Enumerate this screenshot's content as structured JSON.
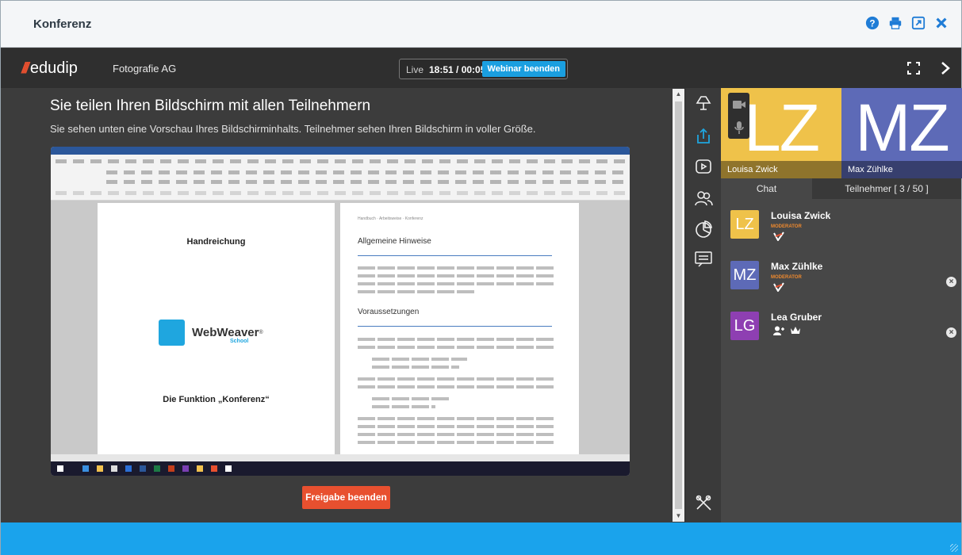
{
  "window": {
    "title": "Konferenz"
  },
  "titlebar_icons": [
    "help-icon",
    "print-icon",
    "popout-icon",
    "close-icon"
  ],
  "appbar": {
    "logo_text": "edudip",
    "course_name": "Fotografie AG",
    "live_label": "Live",
    "time": "18:51 / 00:05",
    "end_webinar_label": "Webinar beenden"
  },
  "main": {
    "heading": "Sie teilen Ihren Bildschirm mit allen Teilnehmern",
    "subheading": "Sie sehen unten eine Vorschau Ihres Bildschirminhalts. Teilnehmer sehen Ihren Bildschirm in voller Größe.",
    "preview": {
      "page1_title": "Handreichung",
      "brand_name": "WebWeaver",
      "brand_mark": "®",
      "brand_sub": "School",
      "page1_heading": "Die Funktion „Konferenz“",
      "page2_crumbs": "Handbuch · Arbeitsweise · Konferenz",
      "page2_h1": "Allgemeine Hinweise",
      "page2_h2": "Voraussetzungen"
    },
    "stop_share_label": "Freigabe beenden"
  },
  "toolbar": {
    "tools": [
      "presenter-icon",
      "share-screen-icon",
      "play-media-icon",
      "participants-icon",
      "poll-icon",
      "chat-board-icon",
      "settings-tools-icon"
    ]
  },
  "panel": {
    "tiles": [
      {
        "initials": "LZ",
        "name": "Louisa Zwick",
        "color": "#efc24a"
      },
      {
        "initials": "MZ",
        "name": "Max Zühlke",
        "color": "#5d6ab7"
      }
    ],
    "tabs": {
      "chat": "Chat",
      "participants": "Teilnehmer [ 3 / 50 ]"
    },
    "participants": [
      {
        "initials": "LZ",
        "name": "Louisa Zwick",
        "role": "MODERATOR",
        "color": "#efc24a"
      },
      {
        "initials": "MZ",
        "name": "Max Zühlke",
        "role": "MODERATOR",
        "color": "#5d6ab7"
      },
      {
        "initials": "LG",
        "name": "Lea Gruber",
        "role": "",
        "color": "#8e3fb2"
      }
    ]
  },
  "colors": {
    "accent": "#1aa3ec",
    "danger": "#e8502f",
    "dark": "#3b3b3b"
  }
}
